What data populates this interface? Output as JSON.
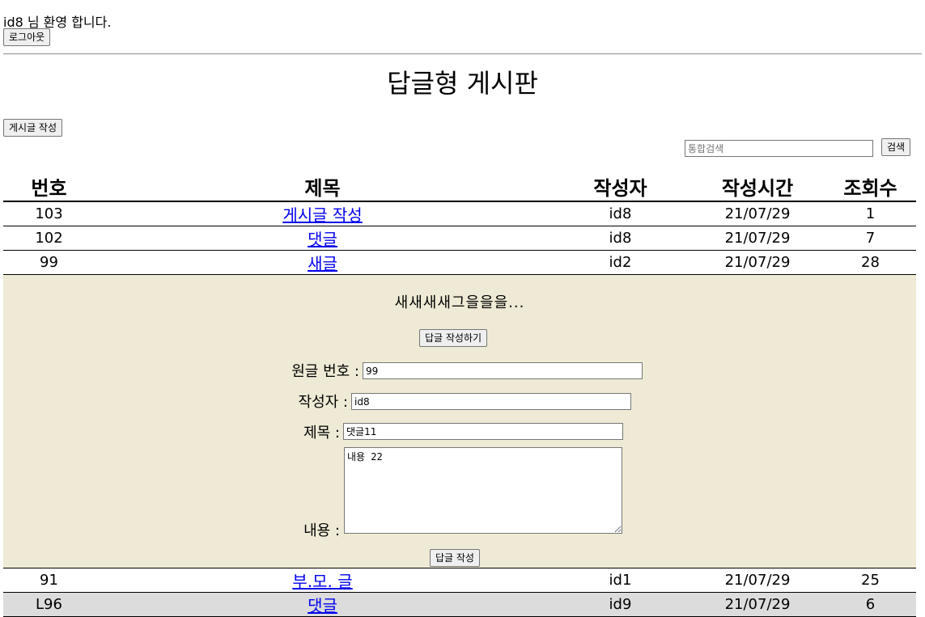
{
  "header": {
    "welcome_text": "id8 님 환영 합니다.",
    "logout_label": "로그아웃"
  },
  "page": {
    "title": "답글형 게시판",
    "write_label": "게시글 작성"
  },
  "search": {
    "placeholder": "통합검색",
    "button_label": "검색"
  },
  "table": {
    "columns": [
      "번호",
      "제목",
      "작성자",
      "작성시간",
      "조회수"
    ],
    "rows": [
      {
        "no": "103",
        "title": "게시글 작성",
        "author": "id8",
        "date": "21/07/29",
        "views": "1"
      },
      {
        "no": "102",
        "title": "댓글",
        "author": "id8",
        "date": "21/07/29",
        "views": "7"
      },
      {
        "no": "99",
        "title": "새글",
        "author": "id2",
        "date": "21/07/29",
        "views": "28"
      },
      {
        "no": "91",
        "title": "부.모. 글",
        "author": "id1",
        "date": "21/07/29",
        "views": "25"
      },
      {
        "no": "L96",
        "title": "댓글",
        "author": "id9",
        "date": "21/07/29",
        "views": "6"
      }
    ]
  },
  "expanded": {
    "content": "새새새새그을을을...",
    "reply_open_label": "답글 작성하기",
    "form": {
      "parent_no_label": "원글 번호 :",
      "parent_no_value": "99",
      "author_label": "작성자 :",
      "author_value": "id8",
      "title_label": "제목 :",
      "title_value": "댓글11",
      "content_label": "내용 :",
      "content_value": "내용 22",
      "submit_label": "답글 작성"
    }
  }
}
